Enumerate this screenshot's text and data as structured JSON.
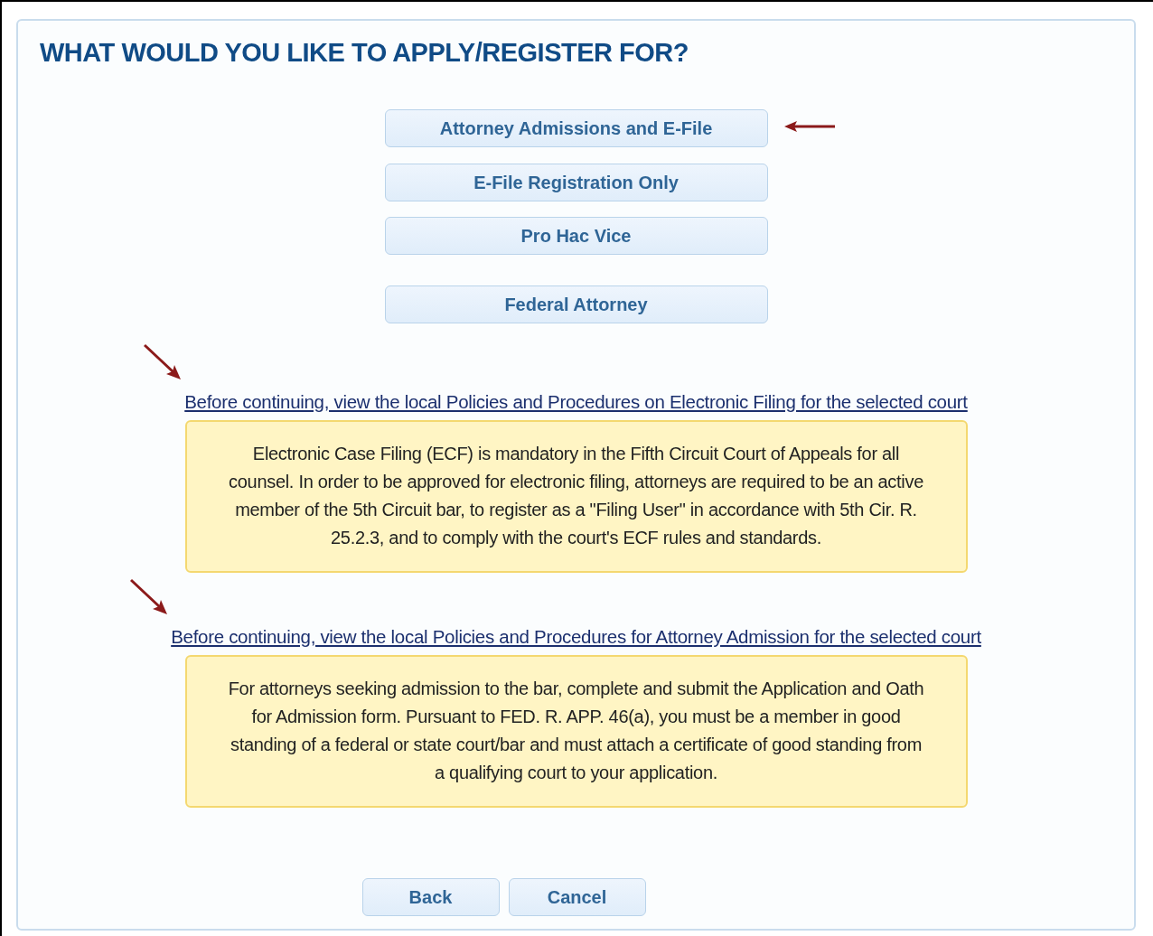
{
  "title": "WHAT WOULD YOU LIKE TO APPLY/REGISTER FOR?",
  "options": [
    {
      "label": "Attorney Admissions and E-File",
      "marked": true
    },
    {
      "label": "E-File Registration Only",
      "marked": false
    },
    {
      "label": "Pro Hac Vice",
      "marked": false
    },
    {
      "label": "Federal Attorney",
      "marked": false
    }
  ],
  "notices": [
    {
      "link": "Before continuing, view the local Policies and Procedures on Electronic Filing for the selected court",
      "marked": true,
      "text": "Electronic Case Filing (ECF) is mandatory in the Fifth Circuit Court of Appeals for all counsel. In order to be approved for electronic filing, attorneys are required to be an active member of the 5th Circuit bar, to register as a \"Filing User\" in accordance with 5th Cir. R. 25.2.3, and to comply with the court's ECF rules and standards."
    },
    {
      "link": "Before continuing, view the local Policies and Procedures for Attorney Admission for the selected court",
      "marked": true,
      "text": "For attorneys seeking admission to the bar, complete and submit the Application and Oath for Admission form. Pursuant to FED. R. APP. 46(a), you must be a member in good standing of a federal or state court/bar and must attach a certificate of good standing from a qualifying court to your application."
    }
  ],
  "buttons": [
    "Back",
    "Cancel"
  ]
}
